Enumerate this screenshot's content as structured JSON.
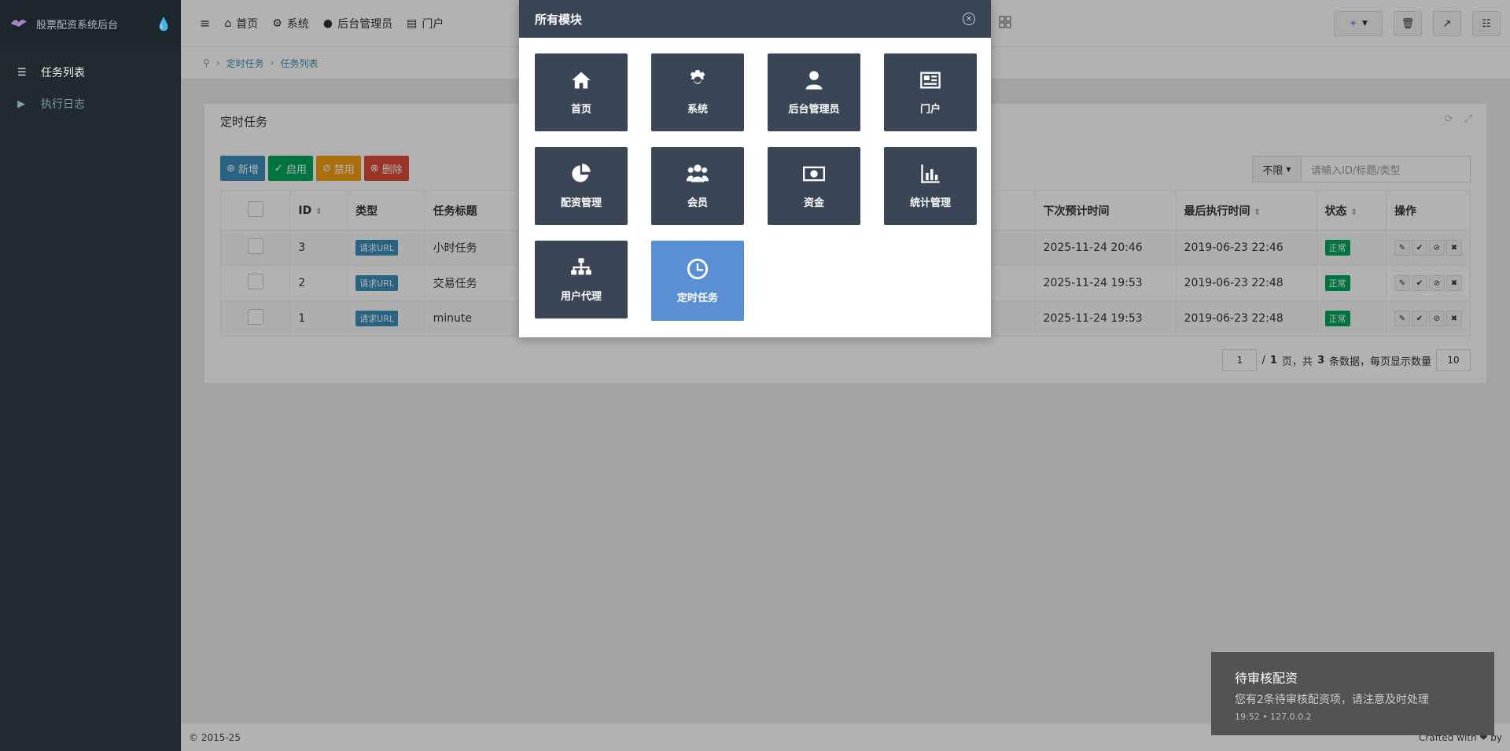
{
  "brand": {
    "name": "股票配资系统后台",
    "drop_icon": "droplet-icon"
  },
  "sidebar": {
    "items": [
      {
        "label": "任务列表",
        "icon": "list-icon",
        "active": true
      },
      {
        "label": "执行日志",
        "icon": "play-icon",
        "active": false
      }
    ]
  },
  "topbar": {
    "menu": [
      {
        "label": "首页",
        "icon": "home-icon"
      },
      {
        "label": "系统",
        "icon": "gear-icon"
      },
      {
        "label": "后台管理员",
        "icon": "user-icon"
      },
      {
        "label": "门户",
        "icon": "newspaper-icon"
      }
    ]
  },
  "breadcrumb": {
    "items": [
      "定时任务",
      "任务列表"
    ]
  },
  "box": {
    "title": "定时任务"
  },
  "actions": {
    "add": "新增",
    "enable": "启用",
    "disable": "禁用",
    "delete": "删除"
  },
  "search": {
    "select": "不限",
    "placeholder": "请输入ID/标题/类型"
  },
  "table": {
    "headers": {
      "id": "ID",
      "type": "类型",
      "title": "任务标题",
      "next": "下次预计时间",
      "last": "最后执行时间",
      "status": "状态",
      "ops": "操作"
    },
    "rows": [
      {
        "id": "3",
        "type": "请求URL",
        "title": "小时任务",
        "next": "2025-11-24 20:46",
        "last": "2019-06-23 22:46",
        "status": "正常"
      },
      {
        "id": "2",
        "type": "请求URL",
        "title": "交易任务",
        "next": "2025-11-24 19:53",
        "last": "2019-06-23 22:48",
        "status": "正常"
      },
      {
        "id": "1",
        "type": "请求URL",
        "title": "minute",
        "next": "2025-11-24 19:53",
        "last": "2019-06-23 22:48",
        "status": "正常"
      }
    ]
  },
  "pager": {
    "page": "1",
    "text_a": "/",
    "total_pages": "1",
    "text_b": "页，共",
    "total_rows": "3",
    "text_c": "条数据，每页显示数量",
    "per_page": "10"
  },
  "footer": {
    "copyright": "© 2015-25",
    "crafted": "Crafted with ❤ by"
  },
  "modal": {
    "title": "所有模块",
    "tiles": [
      {
        "label": "首页",
        "icon": "home-icon"
      },
      {
        "label": "系统",
        "icon": "gear-icon"
      },
      {
        "label": "后台管理员",
        "icon": "user-icon"
      },
      {
        "label": "门户",
        "icon": "newspaper-icon"
      },
      {
        "label": "配资管理",
        "icon": "pie-chart-icon"
      },
      {
        "label": "会员",
        "icon": "users-icon"
      },
      {
        "label": "资金",
        "icon": "money-icon"
      },
      {
        "label": "统计管理",
        "icon": "bar-chart-icon"
      },
      {
        "label": "用户代理",
        "icon": "sitemap-icon"
      },
      {
        "label": "定时任务",
        "icon": "clock-icon",
        "active": true
      }
    ]
  },
  "toast": {
    "title": "待审核配资",
    "message": "您有2条待审核配资项，请注意及时处理",
    "meta": "19:52 • 127.0.0.2"
  }
}
